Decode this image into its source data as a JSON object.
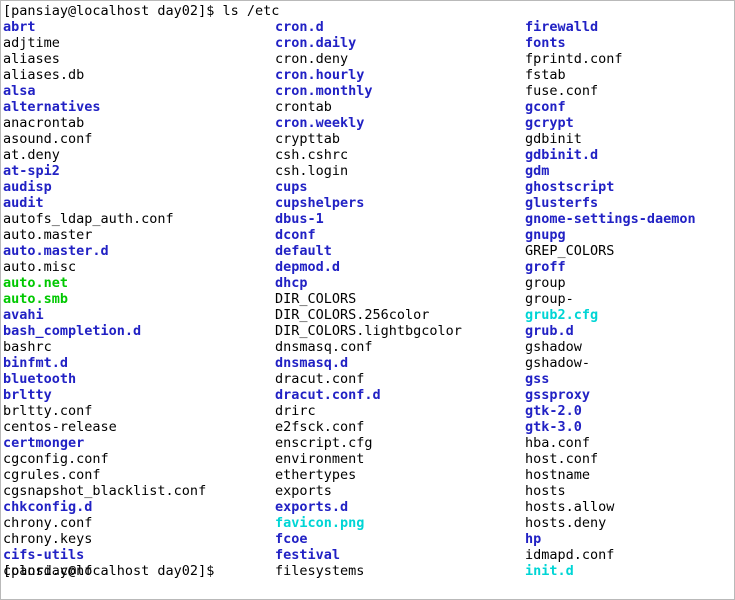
{
  "terminal": {
    "background_color": "#ffffff",
    "foreground_color": "#000000",
    "colors": {
      "directory": "#2121c4",
      "executable": "#00c800",
      "symlink": "#00d5d5",
      "regular_file": "#000000"
    },
    "command_line": "[pansiay@localhost day02]$ ls /etc",
    "trailing_prompt": "[pansiay@localhost day02]$",
    "prompt": "[pansiay@localhost day02]$",
    "command": "ls /etc",
    "columns": [
      {
        "entries": [
          {
            "name": "abrt",
            "type": "dir"
          },
          {
            "name": "adjtime",
            "type": "file"
          },
          {
            "name": "aliases",
            "type": "file"
          },
          {
            "name": "aliases.db",
            "type": "file"
          },
          {
            "name": "alsa",
            "type": "dir"
          },
          {
            "name": "alternatives",
            "type": "dir"
          },
          {
            "name": "anacrontab",
            "type": "file"
          },
          {
            "name": "asound.conf",
            "type": "file"
          },
          {
            "name": "at.deny",
            "type": "file"
          },
          {
            "name": "at-spi2",
            "type": "dir"
          },
          {
            "name": "audisp",
            "type": "dir"
          },
          {
            "name": "audit",
            "type": "dir"
          },
          {
            "name": "autofs_ldap_auth.conf",
            "type": "file"
          },
          {
            "name": "auto.master",
            "type": "file"
          },
          {
            "name": "auto.master.d",
            "type": "dir"
          },
          {
            "name": "auto.misc",
            "type": "file"
          },
          {
            "name": "auto.net",
            "type": "exec"
          },
          {
            "name": "auto.smb",
            "type": "exec"
          },
          {
            "name": "avahi",
            "type": "dir"
          },
          {
            "name": "bash_completion.d",
            "type": "dir"
          },
          {
            "name": "bashrc",
            "type": "file"
          },
          {
            "name": "binfmt.d",
            "type": "dir"
          },
          {
            "name": "bluetooth",
            "type": "dir"
          },
          {
            "name": "brltty",
            "type": "dir"
          },
          {
            "name": "brltty.conf",
            "type": "file"
          },
          {
            "name": "centos-release",
            "type": "file"
          },
          {
            "name": "certmonger",
            "type": "dir"
          },
          {
            "name": "cgconfig.conf",
            "type": "file"
          },
          {
            "name": "cgrules.conf",
            "type": "file"
          },
          {
            "name": "cgsnapshot_blacklist.conf",
            "type": "file"
          },
          {
            "name": "chkconfig.d",
            "type": "dir"
          },
          {
            "name": "chrony.conf",
            "type": "file"
          },
          {
            "name": "chrony.keys",
            "type": "file"
          },
          {
            "name": "cifs-utils",
            "type": "dir"
          },
          {
            "name": "colord.conf",
            "type": "file"
          }
        ]
      },
      {
        "entries": [
          {
            "name": "cron.d",
            "type": "dir"
          },
          {
            "name": "cron.daily",
            "type": "dir"
          },
          {
            "name": "cron.deny",
            "type": "file"
          },
          {
            "name": "cron.hourly",
            "type": "dir"
          },
          {
            "name": "cron.monthly",
            "type": "dir"
          },
          {
            "name": "crontab",
            "type": "file"
          },
          {
            "name": "cron.weekly",
            "type": "dir"
          },
          {
            "name": "crypttab",
            "type": "file"
          },
          {
            "name": "csh.cshrc",
            "type": "file"
          },
          {
            "name": "csh.login",
            "type": "file"
          },
          {
            "name": "cups",
            "type": "dir"
          },
          {
            "name": "cupshelpers",
            "type": "dir"
          },
          {
            "name": "dbus-1",
            "type": "dir"
          },
          {
            "name": "dconf",
            "type": "dir"
          },
          {
            "name": "default",
            "type": "dir"
          },
          {
            "name": "depmod.d",
            "type": "dir"
          },
          {
            "name": "dhcp",
            "type": "dir"
          },
          {
            "name": "DIR_COLORS",
            "type": "file"
          },
          {
            "name": "DIR_COLORS.256color",
            "type": "file"
          },
          {
            "name": "DIR_COLORS.lightbgcolor",
            "type": "file"
          },
          {
            "name": "dnsmasq.conf",
            "type": "file"
          },
          {
            "name": "dnsmasq.d",
            "type": "dir"
          },
          {
            "name": "dracut.conf",
            "type": "file"
          },
          {
            "name": "dracut.conf.d",
            "type": "dir"
          },
          {
            "name": "drirc",
            "type": "file"
          },
          {
            "name": "e2fsck.conf",
            "type": "file"
          },
          {
            "name": "enscript.cfg",
            "type": "file"
          },
          {
            "name": "environment",
            "type": "file"
          },
          {
            "name": "ethertypes",
            "type": "file"
          },
          {
            "name": "exports",
            "type": "file"
          },
          {
            "name": "exports.d",
            "type": "dir"
          },
          {
            "name": "favicon.png",
            "type": "link"
          },
          {
            "name": "fcoe",
            "type": "dir"
          },
          {
            "name": "festival",
            "type": "dir"
          },
          {
            "name": "filesystems",
            "type": "file"
          }
        ]
      },
      {
        "entries": [
          {
            "name": "firewalld",
            "type": "dir"
          },
          {
            "name": "fonts",
            "type": "dir"
          },
          {
            "name": "fprintd.conf",
            "type": "file"
          },
          {
            "name": "fstab",
            "type": "file"
          },
          {
            "name": "fuse.conf",
            "type": "file"
          },
          {
            "name": "gconf",
            "type": "dir"
          },
          {
            "name": "gcrypt",
            "type": "dir"
          },
          {
            "name": "gdbinit",
            "type": "file"
          },
          {
            "name": "gdbinit.d",
            "type": "dir"
          },
          {
            "name": "gdm",
            "type": "dir"
          },
          {
            "name": "ghostscript",
            "type": "dir"
          },
          {
            "name": "glusterfs",
            "type": "dir"
          },
          {
            "name": "gnome-settings-daemon",
            "type": "dir"
          },
          {
            "name": "gnupg",
            "type": "dir"
          },
          {
            "name": "GREP_COLORS",
            "type": "file"
          },
          {
            "name": "groff",
            "type": "dir"
          },
          {
            "name": "group",
            "type": "file"
          },
          {
            "name": "group-",
            "type": "file"
          },
          {
            "name": "grub2.cfg",
            "type": "link"
          },
          {
            "name": "grub.d",
            "type": "dir"
          },
          {
            "name": "gshadow",
            "type": "file"
          },
          {
            "name": "gshadow-",
            "type": "file"
          },
          {
            "name": "gss",
            "type": "dir"
          },
          {
            "name": "gssproxy",
            "type": "dir"
          },
          {
            "name": "gtk-2.0",
            "type": "dir"
          },
          {
            "name": "gtk-3.0",
            "type": "dir"
          },
          {
            "name": "hba.conf",
            "type": "file"
          },
          {
            "name": "host.conf",
            "type": "file"
          },
          {
            "name": "hostname",
            "type": "file"
          },
          {
            "name": "hosts",
            "type": "file"
          },
          {
            "name": "hosts.allow",
            "type": "file"
          },
          {
            "name": "hosts.deny",
            "type": "file"
          },
          {
            "name": "hp",
            "type": "dir"
          },
          {
            "name": "idmapd.conf",
            "type": "file"
          },
          {
            "name": "init.d",
            "type": "link"
          }
        ]
      }
    ]
  }
}
